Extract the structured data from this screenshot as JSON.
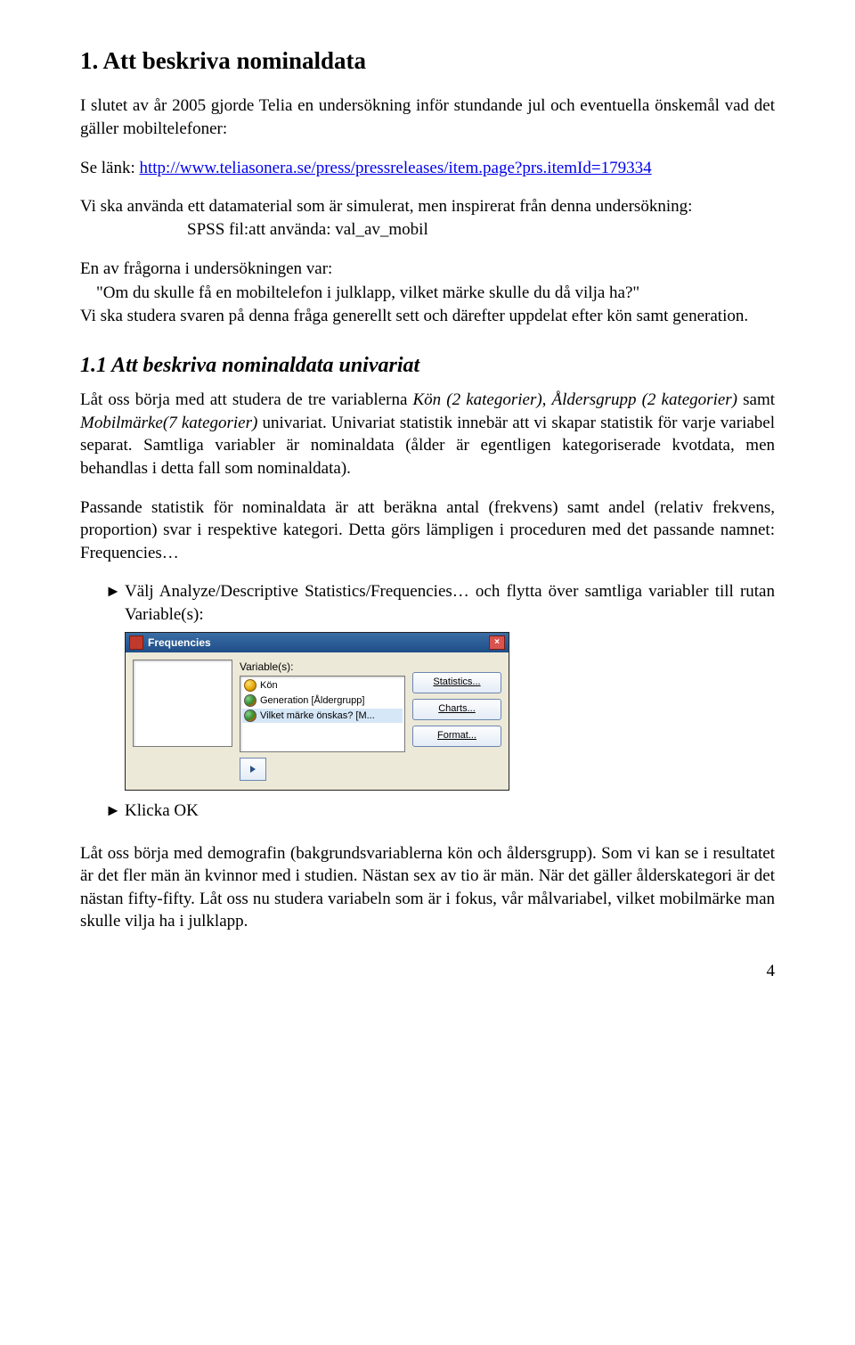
{
  "heading1": "1. Att beskriva nominaldata",
  "p1": "I slutet av år 2005 gjorde Telia en undersökning inför stundande jul och eventuella önskemål vad det gäller mobiltelefoner:",
  "p1b_prefix": "Se länk: ",
  "link": "http://www.teliasonera.se/press/pressreleases/item.page?prs.itemId=179334",
  "indent1": "Vi ska använda ett datamaterial som är simulerat, men inspirerat från denna undersökning:",
  "indent2": "SPSS fil:att använda: val_av_mobil",
  "p2": "En av frågorna i undersökningen var:",
  "quote": "\"Om du skulle få en mobiltelefon i julklapp, vilket märke skulle du då vilja ha?\"",
  "p3": "Vi ska studera svaren på denna fråga generellt sett och därefter uppdelat efter kön samt generation.",
  "heading2": "1.1 Att beskriva nominaldata univariat",
  "p4_a": "Låt oss börja med att studera de tre variablerna ",
  "p4_i1": "Kön (2 kategorier), Åldersgrupp (2 kategorier)",
  "p4_b": " samt ",
  "p4_i2": "Mobilmärke(7 kategorier)",
  "p4_c": " univariat. Univariat statistik innebär att vi skapar statistik för varje variabel separat. Samtliga variabler är nominaldata (ålder är egentligen kategoriserade kvotdata, men behandlas i detta fall som nominaldata).",
  "p5": "Passande statistik för nominaldata är att beräkna antal (frekvens) samt andel (relativ frekvens, proportion) svar i respektive kategori. Detta görs lämpligen i proceduren med det passande namnet: Frequencies…",
  "li1": "Välj Analyze/Descriptive Statistics/Frequencies… och flytta över samtliga variabler till rutan Variable(s):",
  "li2": "Klicka OK",
  "dialog": {
    "title": "Frequencies",
    "var_label": "Variable(s):",
    "vars": [
      "Kön",
      "Generation [Åldergrupp]",
      "Vilket märke önskas? [M..."
    ],
    "buttons": [
      "Statistics...",
      "Charts...",
      "Format..."
    ]
  },
  "p6": "Låt oss börja med demografin (bakgrundsvariablerna kön och åldersgrupp). Som vi kan se i resultatet är det fler män än kvinnor med i studien. Nästan sex av tio är män. När det gäller ålderskategori är det nästan fifty-fifty. Låt oss nu studera variabeln som är i fokus, vår målvariabel, vilket mobilmärke man skulle vilja ha i julklapp.",
  "page": "4"
}
